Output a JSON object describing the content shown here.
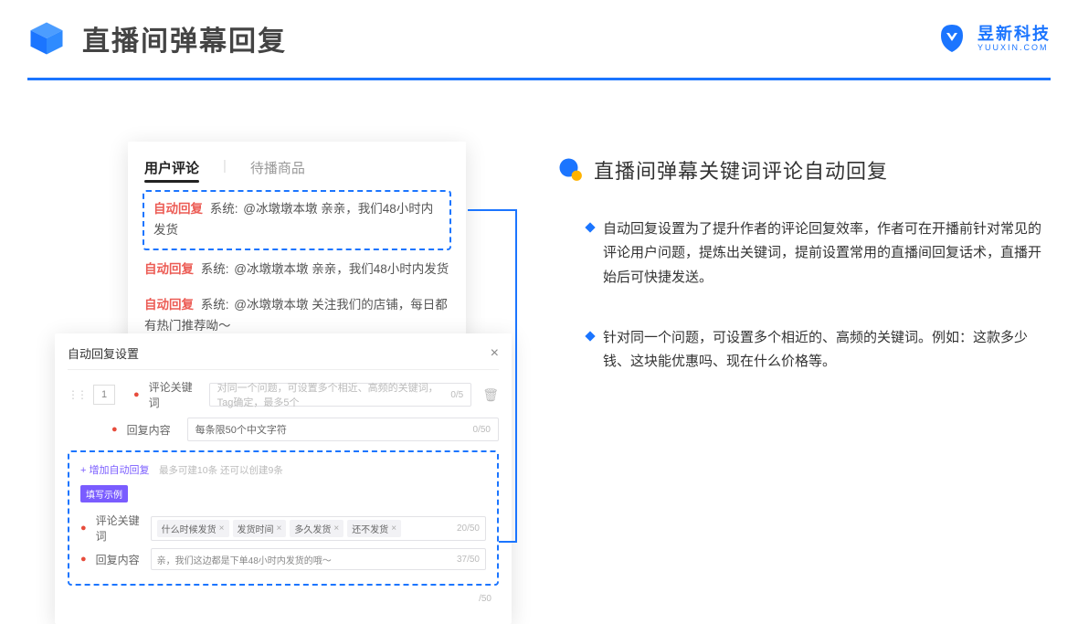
{
  "header": {
    "title": "直播间弹幕回复",
    "brand_cn": "昱新科技",
    "brand_en": "YUUXIN.COM"
  },
  "comments_panel": {
    "tab_active": "用户评论",
    "tab_inactive": "待播商品",
    "auto_label": "自动回复",
    "sys_label": "系统:",
    "row1": "@冰墩墩本墩 亲亲，我们48小时内发货",
    "row2": "@冰墩墩本墩 亲亲，我们48小时内发货",
    "row3": "@冰墩墩本墩 关注我们的店铺，每日都有热门推荐呦～"
  },
  "settings_panel": {
    "title": "自动回复设置",
    "row_number": "1",
    "label_keyword": "评论关键词",
    "placeholder_keyword": "对同一个问题，可设置多个相近、高频的关键词，Tag确定，最多5个",
    "counter_keyword": "0/5",
    "label_reply": "回复内容",
    "placeholder_reply": "每条限50个中文字符",
    "counter_reply": "0/50",
    "add_link": "+ 增加自动回复",
    "add_hint": "最多可建10条 还可以创建9条",
    "example_badge": "填写示例",
    "ex_label_keyword": "评论关键词",
    "ex_tags": [
      "什么时候发货",
      "发货时间",
      "多久发货",
      "还不发货"
    ],
    "ex_counter_keyword": "20/50",
    "ex_label_reply": "回复内容",
    "ex_reply_text": "亲，我们这边都是下单48小时内发货的哦～",
    "ex_counter_reply": "37/50",
    "trailing_counter": "/50"
  },
  "right": {
    "section_title": "直播间弹幕关键词评论自动回复",
    "bullet1": "自动回复设置为了提升作者的评论回复效率，作者可在开播前针对常见的评论用户问题，提炼出关键词，提前设置常用的直播间回复话术，直播开始后可快捷发送。",
    "bullet2": "针对同一个问题，可设置多个相近的、高频的关键词。例如：这款多少钱、这块能优惠吗、现在什么价格等。"
  }
}
